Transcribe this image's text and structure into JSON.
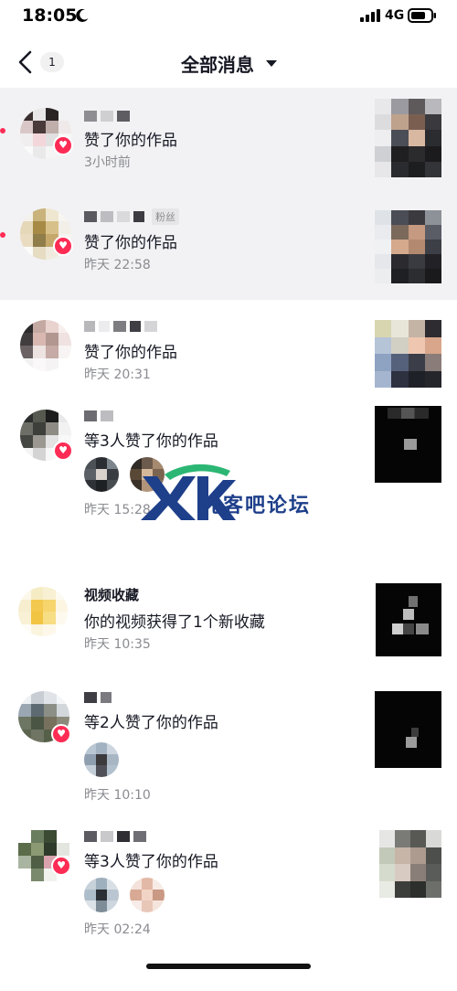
{
  "status_bar": {
    "time": "18:05",
    "network": "4G",
    "icons": [
      "moon-icon",
      "signal-icon",
      "battery-icon"
    ]
  },
  "nav": {
    "back_icon": "chevron-left-icon",
    "count": "1",
    "title": "全部消息",
    "dropdown_icon": "caret-down-icon"
  },
  "notifications": [
    {
      "message": "赞了你的作品",
      "time": "3小时前",
      "tag": ""
    },
    {
      "message": "赞了你的作品",
      "time": "昨天 22:58",
      "tag": "粉丝"
    },
    {
      "message": "赞了你的作品",
      "time": "昨天 20:31",
      "tag": ""
    },
    {
      "message": "等3人赞了你的作品",
      "time": "昨天 15:28",
      "tag": ""
    },
    {
      "name": "视频收藏",
      "message": "你的视频获得了1个新收藏",
      "time": "昨天 10:35"
    },
    {
      "message": "等2人赞了你的作品",
      "time": "昨天 10:10"
    },
    {
      "message": "等3人赞了你的作品",
      "time": "昨天 02:24"
    }
  ],
  "watermark": {
    "logo": "XK",
    "text": "先客吧论坛"
  },
  "colors": {
    "accent": "#fe2c55",
    "unread_background": "#f2f2f4",
    "secondary_text": "#8a8b91",
    "watermark_green": "#2bb673",
    "watermark_blue": "#1e3f8a"
  }
}
